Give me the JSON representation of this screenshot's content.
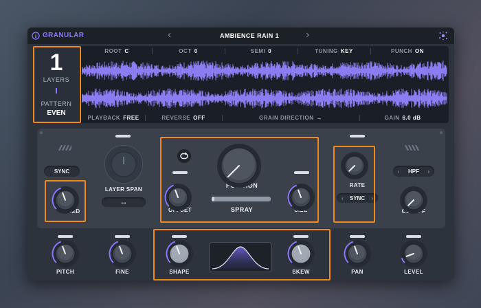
{
  "header": {
    "module_label": "GRANULAR",
    "preset_name": "AMBIENCE RAIN 1",
    "prev_glyph": "‹",
    "next_glyph": "›"
  },
  "layers": {
    "count": "1",
    "label": "LAYERS",
    "pattern_label": "PATTERN",
    "pattern_value": "EVEN"
  },
  "top_params": [
    {
      "label": "ROOT",
      "value": "C"
    },
    {
      "label": "OCT",
      "value": "0"
    },
    {
      "label": "SEMI",
      "value": "0"
    },
    {
      "label": "TUNING",
      "value": "KEY"
    },
    {
      "label": "PUNCH",
      "value": "ON"
    }
  ],
  "bottom_params": [
    {
      "label": "PLAYBACK",
      "value": "FREE"
    },
    {
      "label": "REVERSE",
      "value": "OFF"
    },
    {
      "label": "GRAIN DIRECTION",
      "value": "→"
    },
    {
      "label": "GAIN",
      "value": "6.0 dB"
    }
  ],
  "controls": {
    "sync_left": "SYNC",
    "speed": "SPEED",
    "layer_span": "LAYER SPAN",
    "layer_span_glyph": "↔",
    "position": "POSITION",
    "offset": "OFFSET",
    "spray": "SPRAY",
    "size": "SIZE",
    "rate": "RATE",
    "sync_right": "SYNC",
    "filter_type": "HPF",
    "cutoff": "CUTOFF",
    "pitch": "PITCH",
    "fine": "FINE",
    "shape": "SHAPE",
    "skew": "SKEW",
    "pan": "PAN",
    "level": "LEVEL"
  },
  "colors": {
    "accent": "#8a78ff",
    "waveform": "#8c7cf2",
    "highlight": "#f08a1c",
    "background": "#2d333c"
  },
  "spray_level": 0.05
}
